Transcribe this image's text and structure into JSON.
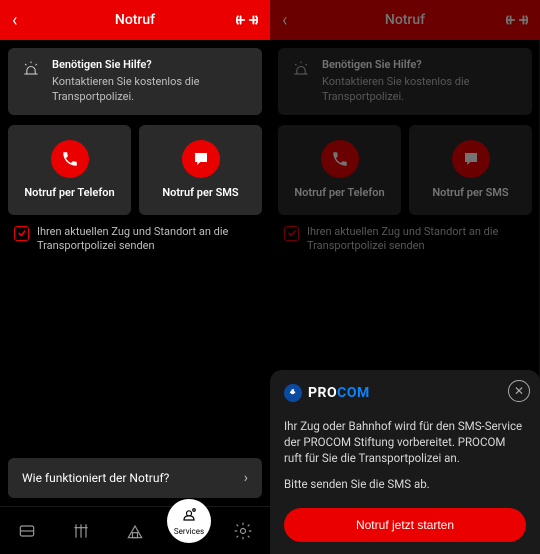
{
  "header": {
    "title": "Notruf"
  },
  "banner": {
    "question": "Benötigen Sie Hilfe?",
    "subtitle": "Kontaktieren Sie kostenlos die Transportpolizei."
  },
  "actions": {
    "phone": "Notruf per Telefon",
    "sms": "Notruf per SMS"
  },
  "checkbox": {
    "label": "Ihren aktuellen Zug und Standort an die Transportpolizei senden"
  },
  "faq": {
    "label": "Wie funktioniert der Notruf?"
  },
  "tabbar": {
    "active_label": "Services"
  },
  "sheet": {
    "brand_part1": "PRO",
    "brand_part2": "COM",
    "body1": "Ihr Zug oder Bahnhof wird für den SMS-Service der PROCOM Stiftung vorbereitet. PROCOM ruft für Sie die Transportpolizei an.",
    "body2": "Bitte senden Sie die SMS ab.",
    "cta": "Notruf jetzt starten"
  }
}
